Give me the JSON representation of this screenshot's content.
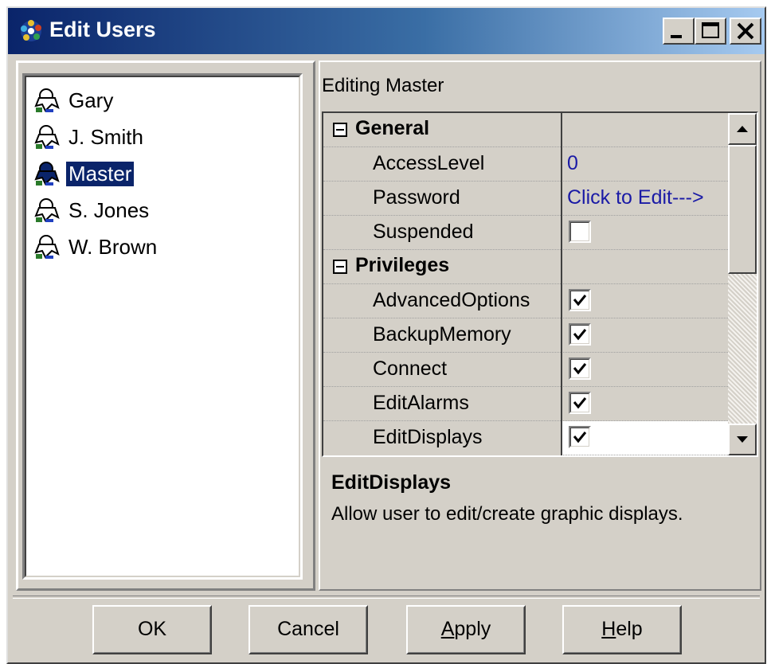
{
  "window": {
    "title": "Edit Users",
    "icon": "users-icon"
  },
  "users": [
    {
      "name": "Gary",
      "selected": false
    },
    {
      "name": "J. Smith",
      "selected": false
    },
    {
      "name": "Master",
      "selected": true
    },
    {
      "name": "S. Jones",
      "selected": false
    },
    {
      "name": "W. Brown",
      "selected": false
    }
  ],
  "editing_label": "Editing Master",
  "property_grid": {
    "categories": [
      {
        "name": "General",
        "collapse_glyph": "−",
        "properties": [
          {
            "name": "AccessLevel",
            "value": "0",
            "type": "text"
          },
          {
            "name": "Password",
            "value": "Click to Edit--->",
            "type": "link"
          },
          {
            "name": "Suspended",
            "checked": false,
            "type": "checkbox"
          }
        ]
      },
      {
        "name": "Privileges",
        "collapse_glyph": "−",
        "properties": [
          {
            "name": "AdvancedOptions",
            "checked": true,
            "type": "checkbox"
          },
          {
            "name": "BackupMemory",
            "checked": true,
            "type": "checkbox"
          },
          {
            "name": "Connect",
            "checked": true,
            "type": "checkbox"
          },
          {
            "name": "EditAlarms",
            "checked": true,
            "type": "checkbox"
          },
          {
            "name": "EditDisplays",
            "checked": true,
            "type": "checkbox",
            "selected": true
          }
        ]
      }
    ]
  },
  "description": {
    "title": "EditDisplays",
    "text": "Allow user to edit/create graphic displays."
  },
  "buttons": {
    "ok": "OK",
    "cancel": "Cancel",
    "apply_mnemonic": "A",
    "apply_rest": "pply",
    "help_mnemonic": "H",
    "help_rest": "elp"
  },
  "colors": {
    "title_gradient_start": "#0a246a",
    "title_gradient_end": "#a6caf0",
    "selection": "#0a246a",
    "value_text": "#1a1aa6",
    "face": "#d4d0c8"
  }
}
